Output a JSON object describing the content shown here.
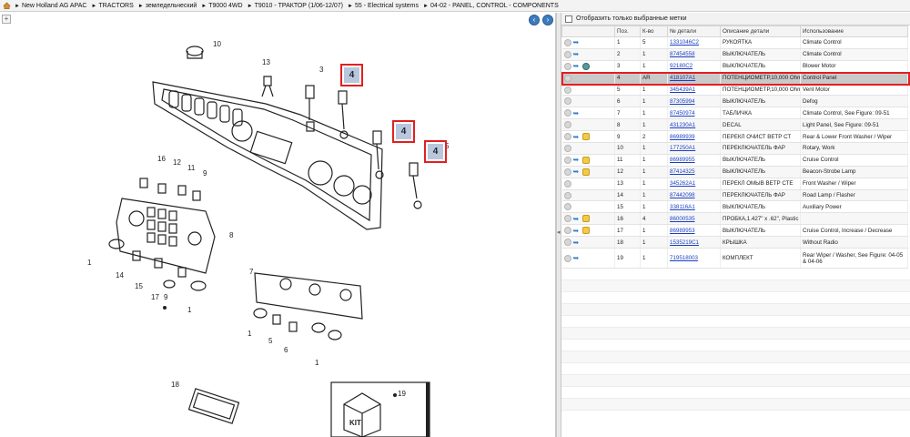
{
  "breadcrumb": [
    "New Holland AG APAC",
    "TRACTORS",
    "земледельческий",
    "T9000 4WD",
    "T9010 - ТРАКТОР (1/06-12/07)",
    "55 - Electrical systems",
    "04-02 - PANEL, CONTROL - COMPONENTS"
  ],
  "filter_label": "Отобразить только выбранные метки",
  "columns": [
    "Поз.",
    "К-во",
    "№ детали",
    "Описание детали",
    "Использование"
  ],
  "diagram": {
    "callouts": [
      "10",
      "13",
      "3",
      "4",
      "4",
      "4",
      "5",
      "16",
      "12",
      "11",
      "9",
      "8",
      "1",
      "14",
      "15",
      "17",
      "9",
      "1",
      "7",
      "1",
      "5",
      "6",
      "1",
      "18",
      "19"
    ],
    "kit_label": "KIT"
  },
  "rows": [
    {
      "pos": "1",
      "qty": "5",
      "part": "1331046C2",
      "desc": "РУКОЯТКА",
      "usage": "Climate Control",
      "icons": [
        "gray",
        "blue"
      ]
    },
    {
      "pos": "2",
      "qty": "1",
      "part": "87454558",
      "desc": "ВЫКЛЮЧАТЕЛЬ",
      "usage": "Climate Control",
      "icons": [
        "gray",
        "blue"
      ]
    },
    {
      "pos": "3",
      "qty": "1",
      "part": "92180C2",
      "desc": "ВЫКЛЮЧАТЕЛЬ",
      "usage": "Blower Motor",
      "icons": [
        "gray",
        "blue",
        "cam"
      ]
    },
    {
      "pos": "4",
      "qty": "AR",
      "part": "418107A1",
      "desc": "ПОТЕНЦИОМЕТР,10,000 Ohm",
      "usage": "Control Panel",
      "icons": [
        "gray"
      ],
      "selected": true
    },
    {
      "pos": "5",
      "qty": "1",
      "part": "345439A1",
      "desc": "ПОТЕНЦИОМЕТР,10,000 Ohm",
      "usage": "Vent Motor",
      "icons": [
        "gray"
      ]
    },
    {
      "pos": "6",
      "qty": "1",
      "part": "87305994",
      "desc": "ВЫКЛЮЧАТЕЛЬ",
      "usage": "Defog",
      "icons": [
        "gray"
      ]
    },
    {
      "pos": "7",
      "qty": "1",
      "part": "87450974",
      "desc": "ТАБЛИЧКА",
      "usage": "Climate Control, See Figure: 09-51",
      "icons": [
        "gray",
        "blue"
      ]
    },
    {
      "pos": "8",
      "qty": "1",
      "part": "431230A1",
      "desc": "DECAL",
      "usage": "Light Panel, See Figure: 09-51",
      "icons": [
        "gray"
      ]
    },
    {
      "pos": "9",
      "qty": "2",
      "part": "86989939",
      "desc": "ПЕРЕКЛ ОЧИСТ ВЕТР СТ",
      "usage": "Rear & Lower Front Washer / Wiper",
      "icons": [
        "gray",
        "blue",
        "yellow"
      ]
    },
    {
      "pos": "10",
      "qty": "1",
      "part": "177250A1",
      "desc": "ПЕРЕКЛЮЧАТЕЛЬ ФАР",
      "usage": "Rotary, Work",
      "icons": [
        "gray"
      ]
    },
    {
      "pos": "11",
      "qty": "1",
      "part": "86989955",
      "desc": "ВЫКЛЮЧАТЕЛЬ",
      "usage": "Cruise Control",
      "icons": [
        "gray",
        "blue",
        "yellow"
      ]
    },
    {
      "pos": "12",
      "qty": "1",
      "part": "87414325",
      "desc": "ВЫКЛЮЧАТЕЛЬ",
      "usage": "Beacon-Strobe Lamp",
      "icons": [
        "gray",
        "blue",
        "yellow"
      ]
    },
    {
      "pos": "13",
      "qty": "1",
      "part": "345262A1",
      "desc": "ПЕРЕКЛ ОМЫВ ВЕТР СТЕ",
      "usage": "Front Washer / Wiper",
      "icons": [
        "gray"
      ]
    },
    {
      "pos": "14",
      "qty": "1",
      "part": "87442098",
      "desc": "ПЕРЕКЛЮЧАТЕЛЬ ФАР",
      "usage": "Road Lamp / Flasher",
      "icons": [
        "gray"
      ]
    },
    {
      "pos": "15",
      "qty": "1",
      "part": "338116A1",
      "desc": "ВЫКЛЮЧАТЕЛЬ",
      "usage": "Auxiliary Power",
      "icons": [
        "gray"
      ]
    },
    {
      "pos": "16",
      "qty": "4",
      "part": "86000535",
      "desc": "ПРОБКА,1.427\" x .62\", Plastic",
      "usage": "",
      "icons": [
        "gray",
        "blue",
        "yellow"
      ]
    },
    {
      "pos": "17",
      "qty": "1",
      "part": "86989953",
      "desc": "ВЫКЛЮЧАТЕЛЬ",
      "usage": "Cruise Control, Increase / Decrease",
      "icons": [
        "gray",
        "blue",
        "yellow"
      ]
    },
    {
      "pos": "18",
      "qty": "1",
      "part": "1535219C1",
      "desc": "КРЫШКА",
      "usage": "Without Radio",
      "icons": [
        "gray",
        "blue"
      ]
    },
    {
      "pos": "19",
      "qty": "1",
      "part": "719518003",
      "desc": "КОМПЛЕКТ",
      "usage": "Rear Wiper / Washer, See Figure: 04-05 & 04-06",
      "icons": [
        "gray",
        "blue"
      ],
      "wrap": true
    }
  ],
  "colors": {
    "highlight": "#e12020",
    "link": "#1a3fc2",
    "selected_row": "#c9c9c9",
    "nav_button": "#3d7bbd"
  }
}
